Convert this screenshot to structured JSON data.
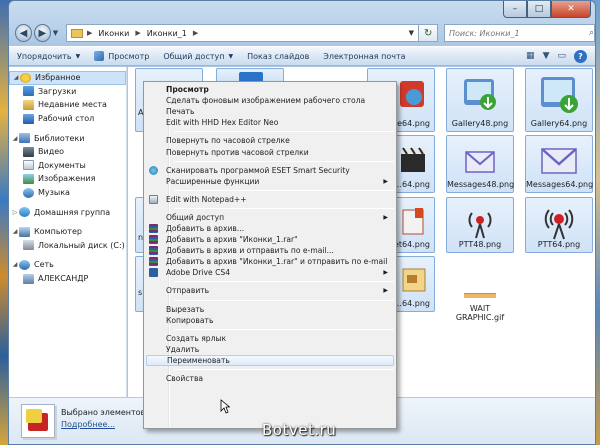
{
  "window": {
    "caption": {
      "minimize": "–",
      "maximize": "□",
      "close": "✕"
    }
  },
  "address": {
    "back_icon": "arrow-left-icon",
    "forward_icon": "arrow-right-icon",
    "crumbs": [
      "Иконки",
      "Иконки_1"
    ],
    "search_placeholder": "Поиск: Иконки_1"
  },
  "toolbar": {
    "organize": "Упорядочить",
    "view": "Просмотр",
    "share": "Общий доступ",
    "slideshow": "Показ слайдов",
    "email": "Электронная почта"
  },
  "nav": {
    "favorites": "Избранное",
    "downloads": "Загрузки",
    "recent": "Недавние места",
    "desktop": "Рабочий стол",
    "libraries": "Библиотеки",
    "video": "Видео",
    "documents": "Документы",
    "images": "Изображения",
    "music": "Музыка",
    "homegroup": "Домашняя группа",
    "computer": "Компьютер",
    "local_disk": "Локальный диск (C:)",
    "network": "Сеть",
    "user_pc": "АЛЕКСАНДР"
  },
  "files": {
    "c1r1": "Ap",
    "c3r1": "…e64.png",
    "gallery48": "Gallery48.png",
    "gallery64": "Gallery64.png",
    "c3r2": "…64.png",
    "messages48": "Messages48.png",
    "messages64": "Messages64.png",
    "c1r3": "n",
    "c3r3": "…et64.png",
    "ptt48": "PTT48.png",
    "ptt64": "PTT64.png",
    "c1r4": "s",
    "c3r4": "…64.png",
    "wait_line1": "WAIT",
    "wait_line2": "GRAPHIC.gif"
  },
  "details": {
    "selected": "Выбрано элементов:",
    "modified": "Подробнее..."
  },
  "menu": {
    "view": "Просмотр",
    "set_wallpaper": "Сделать фоновым изображением рабочего стола",
    "print": "Печать",
    "hex_editor": "Edit with HHD Hex Editor Neo",
    "rotate_cw": "Повернуть по часовой стрелке",
    "rotate_ccw": "Повернуть против часовой стрелки",
    "eset_scan": "Сканировать программой ESET Smart Security",
    "advanced": "Расширенные функции",
    "notepad": "Edit with Notepad++",
    "share": "Общий доступ",
    "add_archive": "Добавить в архив...",
    "add_rar": "Добавить в архив \"Иконки_1.rar\"",
    "add_email": "Добавить в архив и отправить по e-mail...",
    "add_rar_email": "Добавить в архив \"Иконки_1.rar\" и отправить по e-mail",
    "adobe_drive": "Adobe Drive CS4",
    "send_to": "Отправить",
    "cut": "Вырезать",
    "copy": "Копировать",
    "shortcut": "Создать ярлык",
    "delete": "Удалить",
    "rename": "Переименовать",
    "properties": "Свойства"
  },
  "watermark": "Botvet.ru"
}
